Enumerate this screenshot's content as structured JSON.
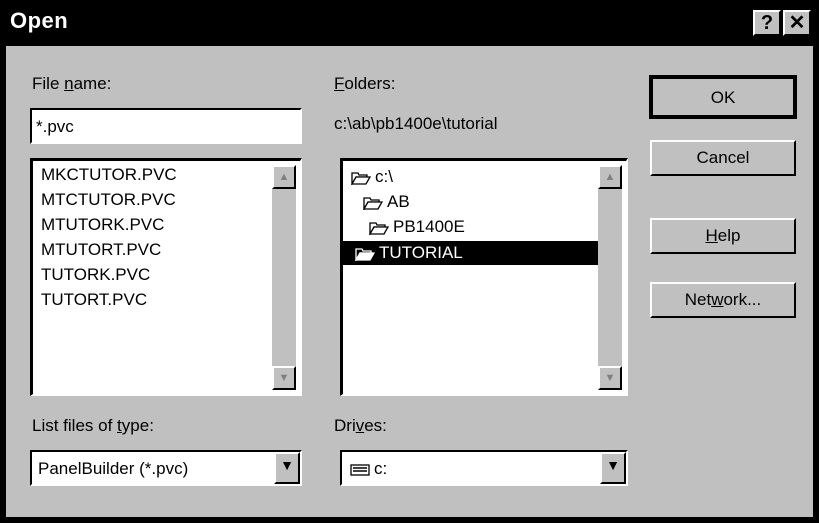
{
  "window": {
    "title": "Open",
    "help_glyph": "?",
    "close_glyph": "✕"
  },
  "file_name": {
    "label_pre": "File ",
    "label_u": "n",
    "label_post": "ame:",
    "value": "*.pvc"
  },
  "files": [
    "MKCTUTOR.PVC",
    "MTCTUTOR.PVC",
    "MTUTORK.PVC",
    "MTUTORT.PVC",
    "TUTORK.PVC",
    "TUTORT.PVC"
  ],
  "folders": {
    "label_u": "F",
    "label_post": "olders:",
    "path": "c:\\ab\\pb1400e\\tutorial",
    "items": [
      {
        "label": "c:\\",
        "icon": "folder-open-icon"
      },
      {
        "label": "AB",
        "icon": "folder-open-icon"
      },
      {
        "label": "PB1400E",
        "icon": "folder-open-icon"
      },
      {
        "label": "TUTORIAL",
        "icon": "folder-open-icon",
        "selected": true
      }
    ]
  },
  "buttons": {
    "ok": "OK",
    "cancel": "Cancel",
    "help_u": "H",
    "help_post": "elp",
    "network_pre": "Net",
    "network_u": "w",
    "network_post": "ork..."
  },
  "file_type": {
    "label_pre": "List files of ",
    "label_u": "t",
    "label_post": "ype:",
    "value": "PanelBuilder (*.pvc)"
  },
  "drives": {
    "label_pre": "Dri",
    "label_u": "v",
    "label_post": "es:",
    "value": "c:",
    "icon": "drive-icon"
  },
  "colors": {
    "face": "#c0c0c0",
    "title": "#000000",
    "selection": "#000000"
  }
}
